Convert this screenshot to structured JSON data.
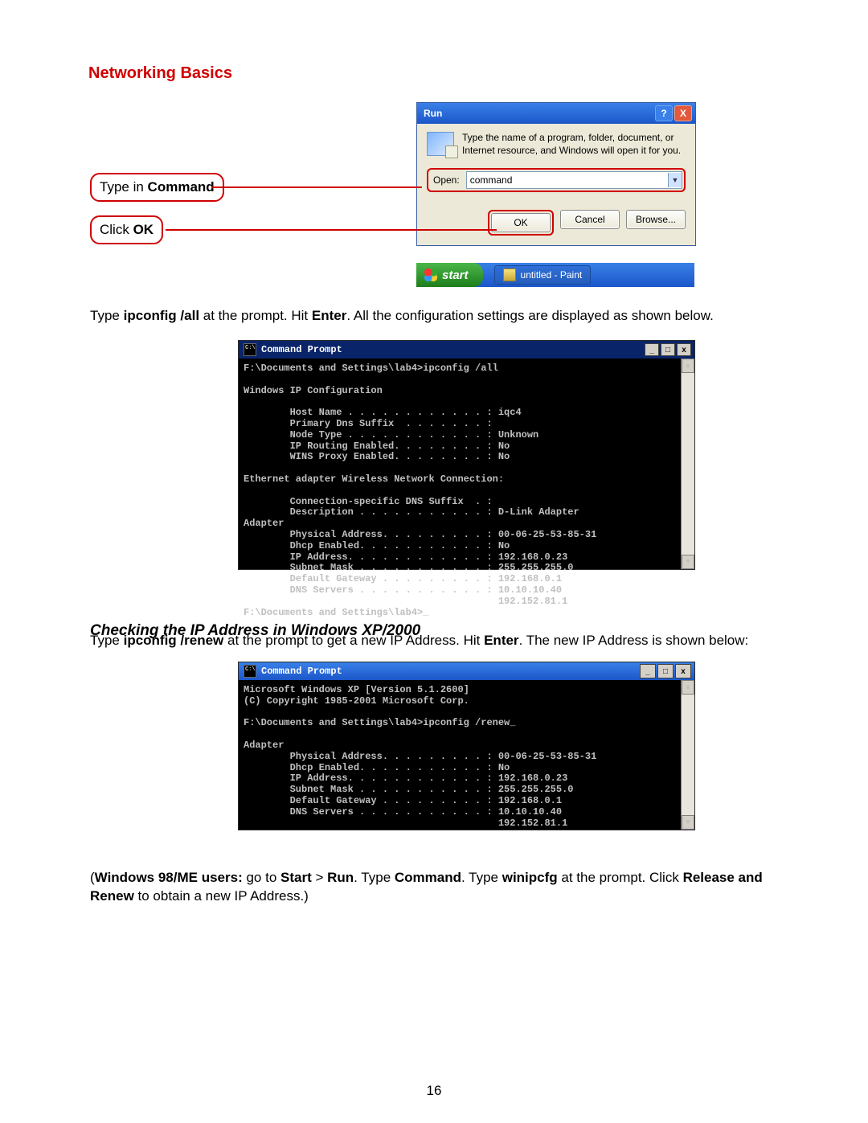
{
  "title": "Networking Basics",
  "callout1_pre": "Type in ",
  "callout1_bold": "Command",
  "callout2_pre": "Click ",
  "callout2_bold": "OK",
  "run": {
    "title": "Run",
    "desc": "Type the name of a program, folder, document, or Internet resource, and Windows will open it for you.",
    "open_label": "Open:",
    "value": "command",
    "ok": "OK",
    "cancel": "Cancel",
    "browse": "Browse..."
  },
  "taskbar": {
    "start": "start",
    "item": "untitled - Paint"
  },
  "para1_a": "Type ",
  "para1_b1": "ipconfig /all",
  "para1_b": " at the prompt.  Hit ",
  "para1_b2": "Enter",
  "para1_c": ".  All the configuration settings are displayed as shown below.",
  "cmd1": {
    "title": "Command Prompt",
    "text": "F:\\Documents and Settings\\lab4>ipconfig /all\n\nWindows IP Configuration\n\n        Host Name . . . . . . . . . . . . : iqc4\n        Primary Dns Suffix  . . . . . . . :\n        Node Type . . . . . . . . . . . . : Unknown\n        IP Routing Enabled. . . . . . . . : No\n        WINS Proxy Enabled. . . . . . . . : No\n\nEthernet adapter Wireless Network Connection:\n\n        Connection-specific DNS Suffix  . :\n        Description . . . . . . . . . . . : D-Link Adapter\nAdapter\n        Physical Address. . . . . . . . . : 00-06-25-53-85-31\n        Dhcp Enabled. . . . . . . . . . . : No\n        IP Address. . . . . . . . . . . . : 192.168.0.23\n        Subnet Mask . . . . . . . . . . . : 255.255.255.0\n        Default Gateway . . . . . . . . . : 192.168.0.1\n        DNS Servers . . . . . . . . . . . : 10.10.10.40\n                                            192.152.81.1\nF:\\Documents and Settings\\lab4>_"
  },
  "subheading": "Checking the IP Address in Windows XP/2000",
  "para2_a": "Type ",
  "para2_b1": "ipconfig /renew",
  "para2_b": " at the prompt to get a new IP Address.  Hit ",
  "para2_b2": "Enter",
  "para2_c": ". The new IP Address is shown below:",
  "cmd2": {
    "title": "Command Prompt",
    "text": "Microsoft Windows XP [Version 5.1.2600]\n(C) Copyright 1985-2001 Microsoft Corp.\n\nF:\\Documents and Settings\\lab4>ipconfig /renew_\n\nAdapter\n        Physical Address. . . . . . . . . : 00-06-25-53-85-31\n        Dhcp Enabled. . . . . . . . . . . : No\n        IP Address. . . . . . . . . . . . : 192.168.0.23\n        Subnet Mask . . . . . . . . . . . : 255.255.255.0\n        Default Gateway . . . . . . . . . : 192.168.0.1\n        DNS Servers . . . . . . . . . . . : 10.10.10.40\n                                            192.152.81.1"
  },
  "para3_a": "(",
  "para3_b1": "Windows 98/ME users:",
  "para3_b": "  go to ",
  "para3_b2": "Start",
  "para3_c": " > ",
  "para3_b3": "Run",
  "para3_d": ".  Type ",
  "para3_b4": "Command",
  "para3_e": ".  Type ",
  "para3_b5": "winipcfg",
  "para3_f": " at the prompt.  Click ",
  "para3_b6": "Release and Renew",
  "para3_g": " to obtain a new IP Address.)",
  "page_number": "16"
}
